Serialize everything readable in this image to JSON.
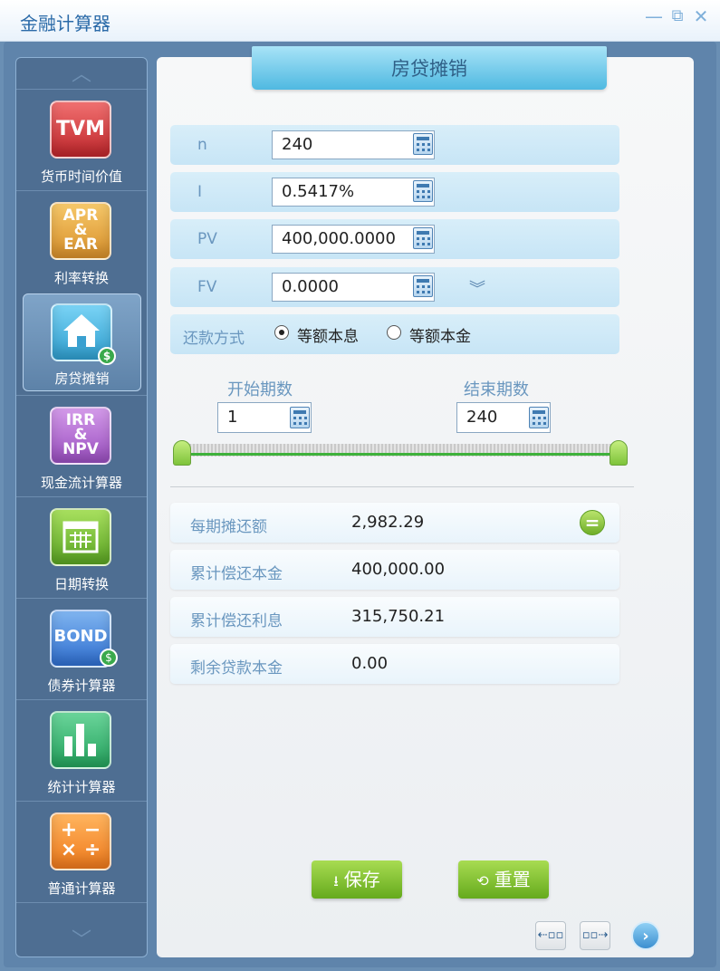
{
  "window": {
    "title": "金融计算器",
    "minimize_icon": "—",
    "popout_icon": "⧉",
    "close_icon": "✕"
  },
  "sidebar": {
    "items": [
      {
        "icon_text": "TVM",
        "label": "货币时间价值"
      },
      {
        "icon_text": "APR & EAR",
        "label": "利率转换"
      },
      {
        "icon_text": "",
        "label": "房贷摊销",
        "active": true
      },
      {
        "icon_text": "IRR & NPV",
        "label": "现金流计算器"
      },
      {
        "icon_text": "",
        "label": "日期转换"
      },
      {
        "icon_text": "BOND",
        "label": "债券计算器"
      },
      {
        "icon_text": "",
        "label": "统计计算器"
      },
      {
        "icon_text": "",
        "label": "普通计算器"
      }
    ]
  },
  "panel": {
    "title": "房贷摊销",
    "inputs": {
      "n": {
        "label": "n",
        "value": "240"
      },
      "i": {
        "label": "I",
        "value": "0.5417%"
      },
      "pv": {
        "label": "PV",
        "value": "400,000.0000"
      },
      "fv": {
        "label": "FV",
        "value": "0.0000"
      }
    },
    "repayment": {
      "label": "还款方式",
      "option1": "等额本息",
      "option2": "等额本金",
      "selected": "等额本息"
    },
    "range": {
      "start_label": "开始期数",
      "start_value": "1",
      "end_label": "结束期数",
      "end_value": "240"
    },
    "results": {
      "payment": {
        "label": "每期摊还额",
        "value": "2,982.29"
      },
      "principal": {
        "label": "累计偿还本金",
        "value": "400,000.00"
      },
      "interest": {
        "label": "累计偿还利息",
        "value": "315,750.21"
      },
      "remaining": {
        "label": "剩余贷款本金",
        "value": "0.00"
      }
    },
    "buttons": {
      "save": "保存",
      "reset": "重置"
    }
  },
  "colors": {
    "accent": "#4fb9e1",
    "green_button": "#7ec33a",
    "sidebar_bg": "#4e6e92"
  }
}
